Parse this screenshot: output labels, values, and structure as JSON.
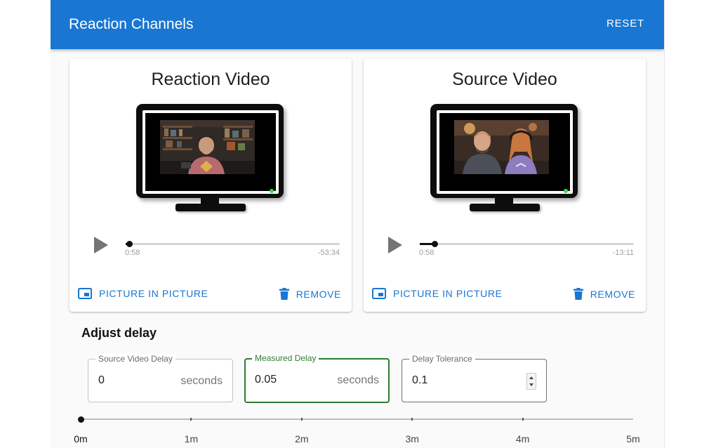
{
  "appbar": {
    "title": "Reaction Channels",
    "reset_label": "RESET"
  },
  "cards": {
    "reaction": {
      "title": "Reaction Video",
      "elapsed": "0:58",
      "remaining": "-53:34",
      "progress": 0.018,
      "pip_label": "PICTURE IN PICTURE",
      "remove_label": "REMOVE"
    },
    "source": {
      "title": "Source Video",
      "elapsed": "0:58",
      "remaining": "-13:11",
      "progress": 0.07,
      "pip_label": "PICTURE IN PICTURE",
      "remove_label": "REMOVE"
    }
  },
  "delay": {
    "section_title": "Adjust delay",
    "source_delay": {
      "label": "Source Video Delay",
      "value": "0",
      "unit": "seconds"
    },
    "measured_delay": {
      "label": "Measured Delay",
      "value": "0.05",
      "unit": "seconds"
    },
    "tolerance": {
      "label": "Delay Tolerance",
      "value": "0.1"
    }
  },
  "timeline": {
    "position": 0,
    "ticks": [
      "0m",
      "1m",
      "2m",
      "3m",
      "4m",
      "5m"
    ]
  },
  "colors": {
    "primary": "#1976d2",
    "active_field": "#2e7d32",
    "tv_led": "#3ddc4a"
  }
}
